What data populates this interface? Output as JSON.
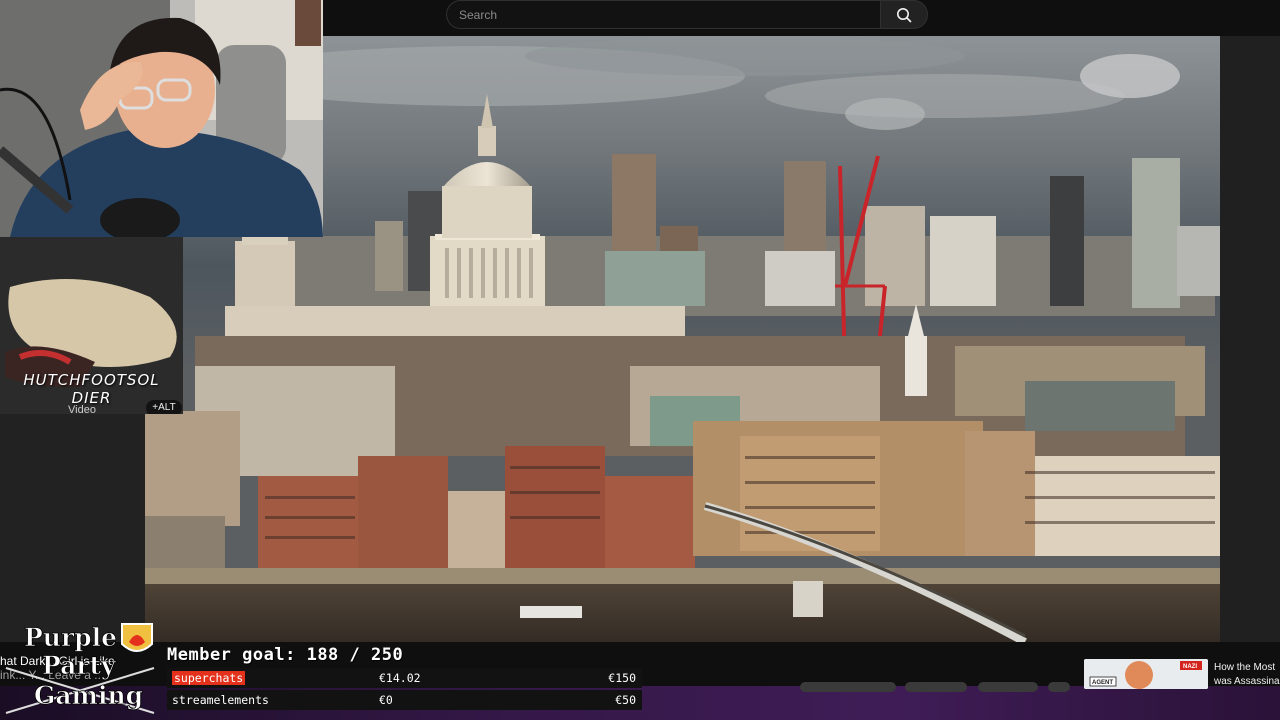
{
  "search": {
    "placeholder": "Search"
  },
  "webcam": {
    "description_icon": "streamer-webcam"
  },
  "video_card": {
    "channel_name_line1": "HUTCHFOOTSOL",
    "channel_name_line2": "DIER",
    "type_label": "Video",
    "alt_label": "+ALT"
  },
  "overlay": {
    "logo_text": [
      "Purple",
      "Party",
      "Gaming"
    ],
    "ticker_lines": [
      "hat Dark... Girl is Like",
      "ink... Y... Leave a ..."
    ],
    "member_goal_label": "Member goal:",
    "member_goal_current": "188",
    "member_goal_separator": "/",
    "member_goal_target": "250",
    "goals": [
      {
        "label": "superchats",
        "current": "€14.02",
        "target": "€150"
      },
      {
        "label": "streamelements",
        "current": "€0",
        "target": "€50"
      }
    ]
  },
  "recommended": {
    "badge_left": "AGENT",
    "badge_right": "NAZI",
    "title_line1": "How the Most",
    "title_line2": "was Assassina"
  },
  "colors": {
    "accent_red": "#e4311b",
    "purple": "#3f1c56",
    "background": "#0f0f0f"
  }
}
